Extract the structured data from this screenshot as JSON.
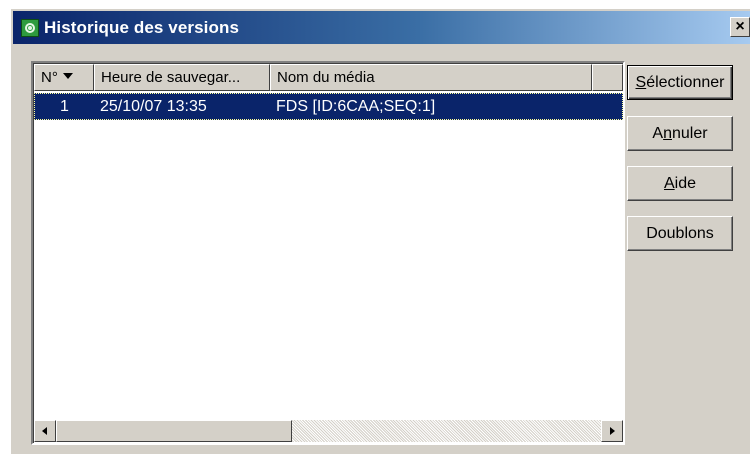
{
  "window": {
    "title": "Historique des versions",
    "close_glyph": "×"
  },
  "columns": [
    {
      "label": "N°",
      "sorted": "descending"
    },
    {
      "label": "Heure de sauvegar..."
    },
    {
      "label": "Nom du média"
    }
  ],
  "rows": [
    {
      "number": "1",
      "time": "25/10/07 13:35",
      "media": "FDS [ID:6CAA;SEQ:1]",
      "selected": true
    }
  ],
  "buttons": {
    "select": {
      "first": "S",
      "rest": "électionner"
    },
    "cancel": {
      "first": "A",
      "u": "n",
      "rest": "nuler"
    },
    "help": {
      "first": "A",
      "rest": "ide"
    },
    "duplicates": "Doublons"
  },
  "colors": {
    "selection": "#0a246a",
    "dialog_bg": "#d4d0c8",
    "title_gradient_start": "#0a246a",
    "title_gradient_end": "#a6caf0"
  },
  "icons": {
    "title": "app-globe-icon",
    "sort": "sort-descending-icon",
    "scroll_left": "arrow-left-icon",
    "scroll_right": "arrow-right-icon"
  }
}
